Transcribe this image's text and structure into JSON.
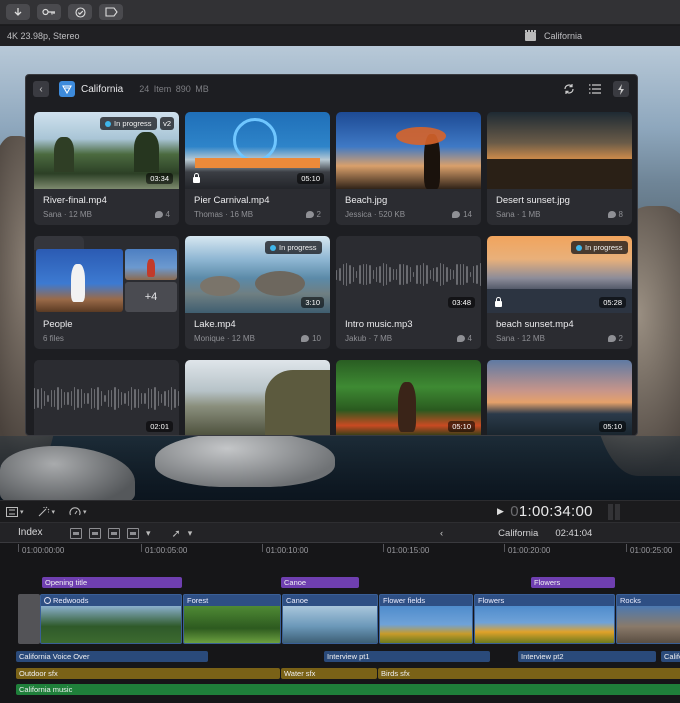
{
  "toolbar": {
    "buttons": [
      "import-icon",
      "keyword-icon",
      "check-icon",
      "clip-icon"
    ]
  },
  "infobar": {
    "format": "4K 23.98p, Stereo",
    "project": "California"
  },
  "browser": {
    "library": "California",
    "meta": "24 Item  890 MB",
    "items": [
      {
        "name": "River-final.mp4",
        "owner": "Sana",
        "size": "12 MB",
        "comments": "4",
        "duration": "03:34",
        "status": "In progress",
        "version": "v2"
      },
      {
        "name": "Pier Carnival.mp4",
        "owner": "Thomas",
        "size": "16 MB",
        "comments": "2",
        "duration": "05:10",
        "locked": true
      },
      {
        "name": "Beach.jpg",
        "owner": "Jessica",
        "size": "520 KB",
        "comments": "14"
      },
      {
        "name": "Desert sunset.jpg",
        "owner": "Sana",
        "size": "1 MB",
        "comments": "8"
      },
      {
        "name": "People",
        "sub": "6 files",
        "more": "+4"
      },
      {
        "name": "Lake.mp4",
        "owner": "Monique",
        "size": "12 MB",
        "comments": "10",
        "duration": "3:10",
        "status": "In progress"
      },
      {
        "name": "Intro music.mp3",
        "owner": "Jakub",
        "size": "7 MB",
        "comments": "4",
        "duration": "03:48"
      },
      {
        "name": "beach sunset.mp4",
        "owner": "Sana",
        "size": "12 MB",
        "comments": "2",
        "duration": "05:28",
        "status": "In progress",
        "locked": true
      },
      {
        "duration": "02:01"
      },
      {},
      {
        "duration": "05:10"
      },
      {
        "duration": "05:10"
      }
    ]
  },
  "playback": {
    "timecode_dim": "0",
    "timecode": "1:00:34:00"
  },
  "timeline_header": {
    "index": "Index",
    "project": "California",
    "duration": "02:41:04"
  },
  "ruler": [
    "01:00:00:00",
    "01:00:05:00",
    "01:00:10:00",
    "01:00:15:00",
    "01:00:20:00",
    "01:00:25:00"
  ],
  "tracks": {
    "titles": [
      "Opening title",
      "Canoe",
      "Flowers"
    ],
    "video": [
      "Redwoods",
      "Forest",
      "Canoe",
      "Flower fields",
      "Flowers",
      "Rocks"
    ],
    "voice": [
      "California Voice Over",
      "Interview pt1",
      "Interview pt2",
      "Califo"
    ],
    "sfx": [
      "Outdoor sfx",
      "Water sfx",
      "Birds sfx"
    ],
    "music": [
      "California music"
    ]
  },
  "colors": {
    "accent": "#3d8bdc",
    "title_clip": "#6f3fb0",
    "voice_clip": "#2a4a7a",
    "sfx_clip": "#7a6217",
    "music_clip": "#1f7f3a",
    "status_dot": "#3fb6ea"
  }
}
